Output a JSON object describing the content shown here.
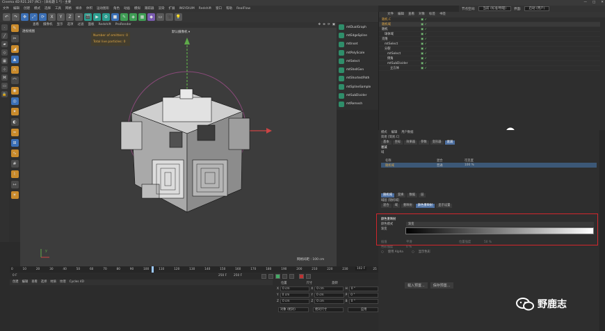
{
  "window": {
    "title": "Cinema 4D R21.207 (RC) - [未标题 1 *] - 主要",
    "controls": [
      "—",
      "□",
      "✕"
    ]
  },
  "menubar": [
    "文件",
    "编辑",
    "创建",
    "模式",
    "选择",
    "工具",
    "网格",
    "样条",
    "体积",
    "运动图形",
    "角色",
    "动画",
    "模拟",
    "跟踪器",
    "渲染",
    "扩展",
    "INSYDIUM",
    "Redshift",
    "窗口",
    "帮助",
    "RealFlow"
  ],
  "layout": {
    "label_nodes": "节点空间:",
    "nodes_value": "当前 (标准/物理)",
    "label_layout": "界面:",
    "layout_value": "启动 (用户)"
  },
  "toolbar_icons": [
    "undo-icon",
    "redo-icon",
    "move-icon",
    "scale-icon",
    "rotate-icon",
    "x-axis-icon",
    "y-axis-icon",
    "z-axis-icon",
    "coord-icon",
    "render-view-icon",
    "render-icon",
    "render-settings-icon",
    "cube-icon",
    "pen-icon",
    "subdivision-icon",
    "array-icon",
    "deformer-icon",
    "floor-icon",
    "camera-icon",
    "light-icon"
  ],
  "toolbar_glyphs": [
    "↶",
    "↷",
    "✥",
    "⤢",
    "⟳",
    "X",
    "Y",
    "Z",
    "⌖",
    "🎬",
    "▶",
    "⚙",
    "■",
    "✎",
    "◈",
    "▦",
    "◆",
    "▭",
    "🎥",
    "💡"
  ],
  "viewport": {
    "menu": [
      "查看",
      "摄像机",
      "显示",
      "选项",
      "过滤",
      "面板",
      "Redshift",
      "ProRender"
    ],
    "label": "透视视图",
    "camera": "默认摄像机 ▾",
    "hud": [
      "Number of emitters: 0",
      "Total live particles: 0"
    ],
    "grid_info": "网格间距 : 100 cm"
  },
  "plugins": [
    "mtDualGraph",
    "mtEdgeSpline",
    "mtInset",
    "mtPolyScale",
    "mtSelect",
    "mtShellGen",
    "mtShortestPath",
    "mtSplineSample",
    "mtSubDivider",
    "mtRemesh"
  ],
  "object_manager": {
    "menu": [
      "文件",
      "编辑",
      "查看",
      "对象",
      "标签",
      "书签"
    ],
    "rows": [
      {
        "name": "随机.C",
        "color": "#e0a847",
        "checks": "▣ ✓"
      },
      {
        "name": "随机域",
        "color": "#e0a847",
        "checks": "▣ ✓"
      },
      {
        "name": "随机",
        "color": "#cfcfcf",
        "checks": "▣ ✓"
      },
      {
        "name": "球体域",
        "color": "#cfcfcf",
        "checks": "▣ ✓"
      },
      {
        "name": "克隆",
        "color": "#cfcfcf",
        "checks": "▣ ✓"
      },
      {
        "name": "mtSelect",
        "color": "#cfcfcf",
        "checks": "▣ ✓"
      },
      {
        "name": "分裂",
        "color": "#cfcfcf",
        "checks": "▣ ✓"
      },
      {
        "name": "mtSelect",
        "color": "#cfcfcf",
        "checks": "▣ ✓"
      },
      {
        "name": "倒角",
        "color": "#cfcfcf",
        "checks": "▣ ✓"
      },
      {
        "name": "mtSubDivider",
        "color": "#cfcfcf",
        "checks": "▣ ✓"
      },
      {
        "name": "立方体",
        "color": "#cfcfcf",
        "checks": "▣ ✓"
      }
    ]
  },
  "attributes": {
    "menu": [
      "模式",
      "编辑",
      "用户数据"
    ],
    "object": "简易 [简易.C]",
    "tabs": [
      "基本",
      "坐标",
      "效果器",
      "参数",
      "变形器",
      "衰减"
    ],
    "active_tab": "衰减",
    "section": "衰减",
    "field_label": "域",
    "table_head": [
      "名称",
      "混合",
      "可见度"
    ],
    "layer_row": {
      "name": "随机域",
      "blend": "普通",
      "value": "100 %"
    }
  },
  "attributes2": {
    "tabs": [
      "随机域",
      "变换",
      "数据",
      "层"
    ],
    "object": "域层 [随机域]",
    "subtabs": [
      "混合",
      "域",
      "重映射",
      "颜色重映射",
      "显示设置"
    ],
    "active_subtab": "颜色重映射",
    "section": "颜色重映射",
    "color_mode_label": "颜色模式",
    "color_mode": "渐变",
    "gradient_label": "渐变",
    "interp_label": "插值",
    "interp_value": "平滑",
    "pos_label": "位置强度",
    "pos_value": "50 %",
    "bias_label": "色彩强度",
    "bias_value": "0 %",
    "alpha_label": "使用 Alpha",
    "invert_label": "显示色彩",
    "btn_load": "载入预置...",
    "btn_save": "保存预置..."
  },
  "timeline": {
    "ticks": [
      "0",
      "10",
      "20",
      "30",
      "40",
      "50",
      "60",
      "70",
      "80",
      "90",
      "100",
      "110",
      "120",
      "130",
      "140",
      "150",
      "160",
      "170",
      "180",
      "190",
      "200",
      "210",
      "220",
      "230",
      "240",
      "25"
    ],
    "current": "102 F",
    "start": "0 F",
    "end": "250 F",
    "end2": "250 F",
    "frame": "0 F"
  },
  "materials": {
    "menu": [
      "创建",
      "编辑",
      "查看",
      "选择",
      "材质",
      "纹理",
      "Cycles 4D"
    ]
  },
  "coords": {
    "heads": [
      "位置",
      "尺寸",
      "旋转"
    ],
    "rows": [
      {
        "axis": "X",
        "pos": "0 cm",
        "size": "0 cm",
        "rotl": "H",
        "rot": "0 °"
      },
      {
        "axis": "Y",
        "pos": "0 cm",
        "size": "0 cm",
        "rotl": "P",
        "rot": "0 °"
      },
      {
        "axis": "Z",
        "pos": "0 cm",
        "size": "0 cm",
        "rotl": "B",
        "rot": "0 °"
      }
    ],
    "mode": "对象 (相对)",
    "size_mode": "绝对尺寸",
    "apply": "应用"
  },
  "watermark": "野鹿志"
}
